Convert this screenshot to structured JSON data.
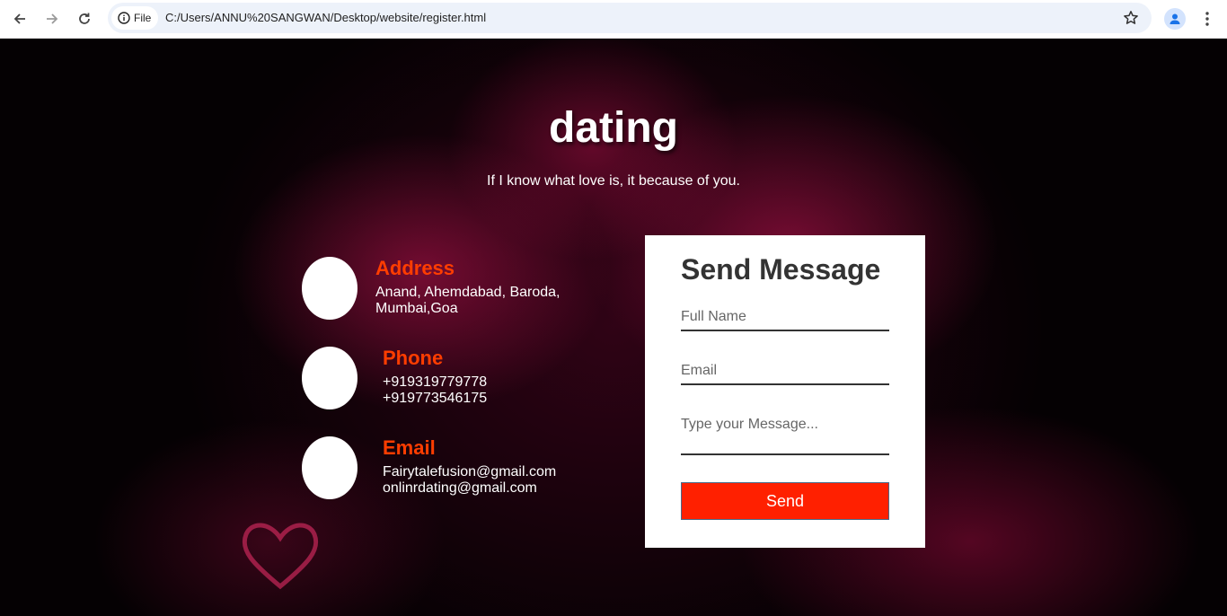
{
  "browser": {
    "url_chip_label": "File",
    "url": "C:/Users/ANNU%20SANGWAN/Desktop/website/register.html"
  },
  "hero": {
    "title": "dating",
    "tagline": "If I know what love is, it because of you."
  },
  "contact": {
    "address": {
      "title": "Address",
      "line1": "Anand, Ahemdabad, Baroda,",
      "line2": "Mumbai,Goa"
    },
    "phone": {
      "title": "Phone",
      "line1": "+919319779778",
      "line2": "+919773546175"
    },
    "email": {
      "title": "Email",
      "line1": "Fairytalefusion@gmail.com",
      "line2": "onlinrdating@gmail.com"
    }
  },
  "form": {
    "title": "Send Message",
    "name_placeholder": "Full Name",
    "email_placeholder": "Email",
    "message_placeholder": "Type your Message...",
    "send_label": "Send"
  },
  "colors": {
    "accent_orange": "#ff3d00",
    "send_button": "#ff2000",
    "background": "#050103"
  }
}
